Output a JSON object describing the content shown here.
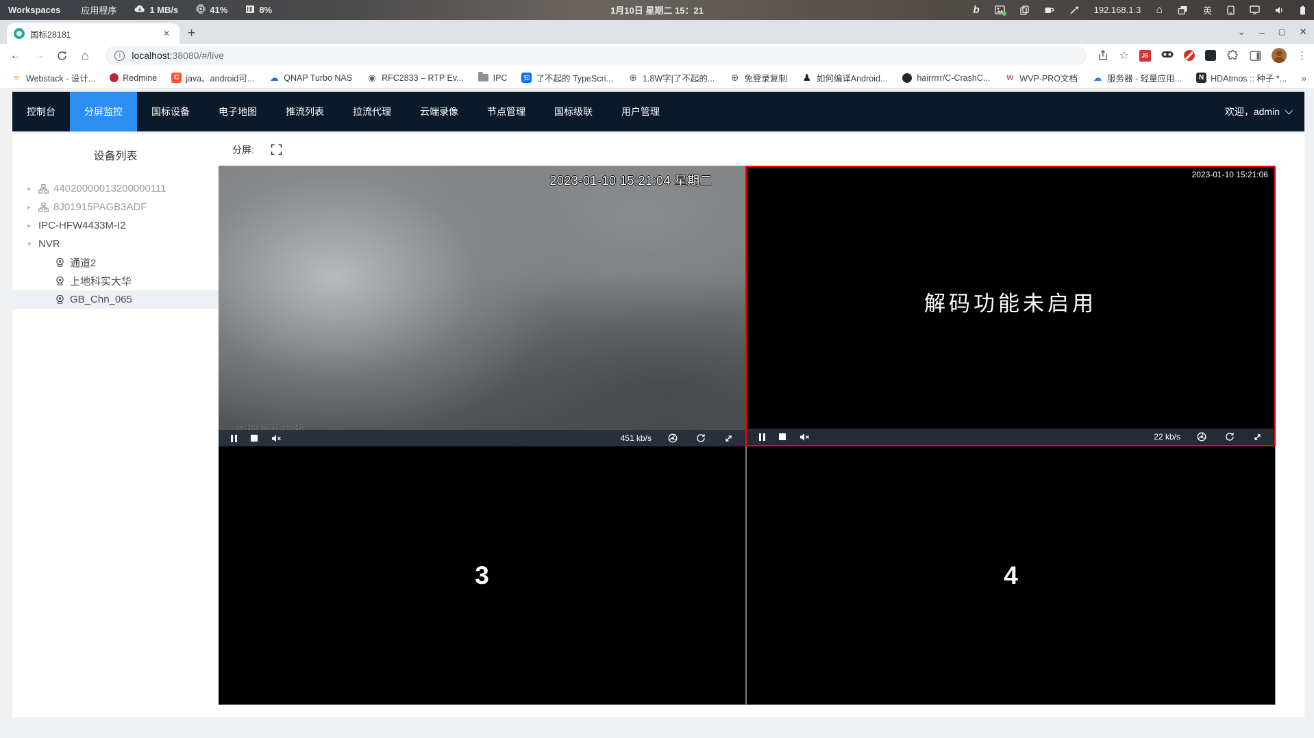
{
  "glyphs": {
    "tab_close": "✕",
    "new_tab": "+",
    "back": "←",
    "forward": "→",
    "home": "⌂",
    "star": "☆",
    "menu_dots": "⋮",
    "window_chevron": "⌄",
    "minimize": "–",
    "maximize": "▢",
    "close": "✕",
    "overflow": "»",
    "info": "i",
    "js_badge": "JS",
    "bing": "b"
  },
  "system_bar": {
    "workspaces_label": "Workspaces",
    "applications_label": "应用程序",
    "net_speed": "1 MB/s",
    "cpu_usage": "41%",
    "mem_usage": "8%",
    "clock": "1月10日 星期二 15：21",
    "ip_address": "192.168.1.3",
    "input_method": "英"
  },
  "browser": {
    "tab_title": "国标28181",
    "url_host": "localhost",
    "url_rest": ":38080/#/live",
    "bookmarks": [
      {
        "label": "Webstack - 设计...",
        "glyph": "≡"
      },
      {
        "label": "Redmine",
        "glyph": ""
      },
      {
        "label": "java、android可...",
        "glyph": "C"
      },
      {
        "label": "QNAP Turbo NAS",
        "glyph": "☁"
      },
      {
        "label": "RFC2833 – RTP Ev...",
        "glyph": "◉"
      },
      {
        "label": "IPC",
        "glyph": ""
      },
      {
        "label": "了不起的 TypeScri...",
        "glyph": "知"
      },
      {
        "label": "1.8W字|了不起的...",
        "glyph": "⊕"
      },
      {
        "label": "免登录复制",
        "glyph": "⊕"
      },
      {
        "label": "如何编译Android...",
        "glyph": "♟"
      },
      {
        "label": "hairrrrr/C-CrashC...",
        "glyph": ""
      },
      {
        "label": "WVP-PRO文档",
        "glyph": "W"
      },
      {
        "label": "服务器 - 轻量应用...",
        "glyph": "☁"
      },
      {
        "label": "HDAtmos :: 种子 *...",
        "glyph": "N"
      }
    ]
  },
  "nav": {
    "items": [
      {
        "label": "控制台"
      },
      {
        "label": "分屏监控"
      },
      {
        "label": "国标设备"
      },
      {
        "label": "电子地图"
      },
      {
        "label": "推流列表"
      },
      {
        "label": "拉流代理"
      },
      {
        "label": "云端录像"
      },
      {
        "label": "节点管理"
      },
      {
        "label": "国标级联"
      },
      {
        "label": "用户管理"
      }
    ],
    "welcome": "欢迎，admin"
  },
  "sidebar": {
    "title": "设备列表",
    "items": [
      {
        "label": "44020000013200000111",
        "caret": "▸"
      },
      {
        "label": "8J01915PAGB3ADF",
        "caret": "▸"
      },
      {
        "label": "IPC-HFW4433M-I2",
        "caret": "▸"
      },
      {
        "label": "NVR",
        "caret": "▾"
      },
      {
        "label": "通道2",
        "caret": ""
      },
      {
        "label": "上地科实大华",
        "caret": ""
      },
      {
        "label": "GB_Chn_065",
        "caret": ""
      }
    ]
  },
  "main": {
    "split_label": "分屏:"
  },
  "players": [
    {
      "timestamp": "2023-01-10 15:21:04 星期二",
      "watermark": "上地科实大华",
      "bitrate": "451 kb/s"
    },
    {
      "timestamp": "2023-01-10 15:21:06",
      "message": "解码功能未启用",
      "bitrate": "22 kb/s"
    },
    {
      "placeholder": "3"
    },
    {
      "placeholder": "4"
    }
  ],
  "colors": {
    "accent": "#2b8ef0",
    "navbar_bg": "#0a1a2b",
    "selected_cell_border": "#fe0000"
  }
}
